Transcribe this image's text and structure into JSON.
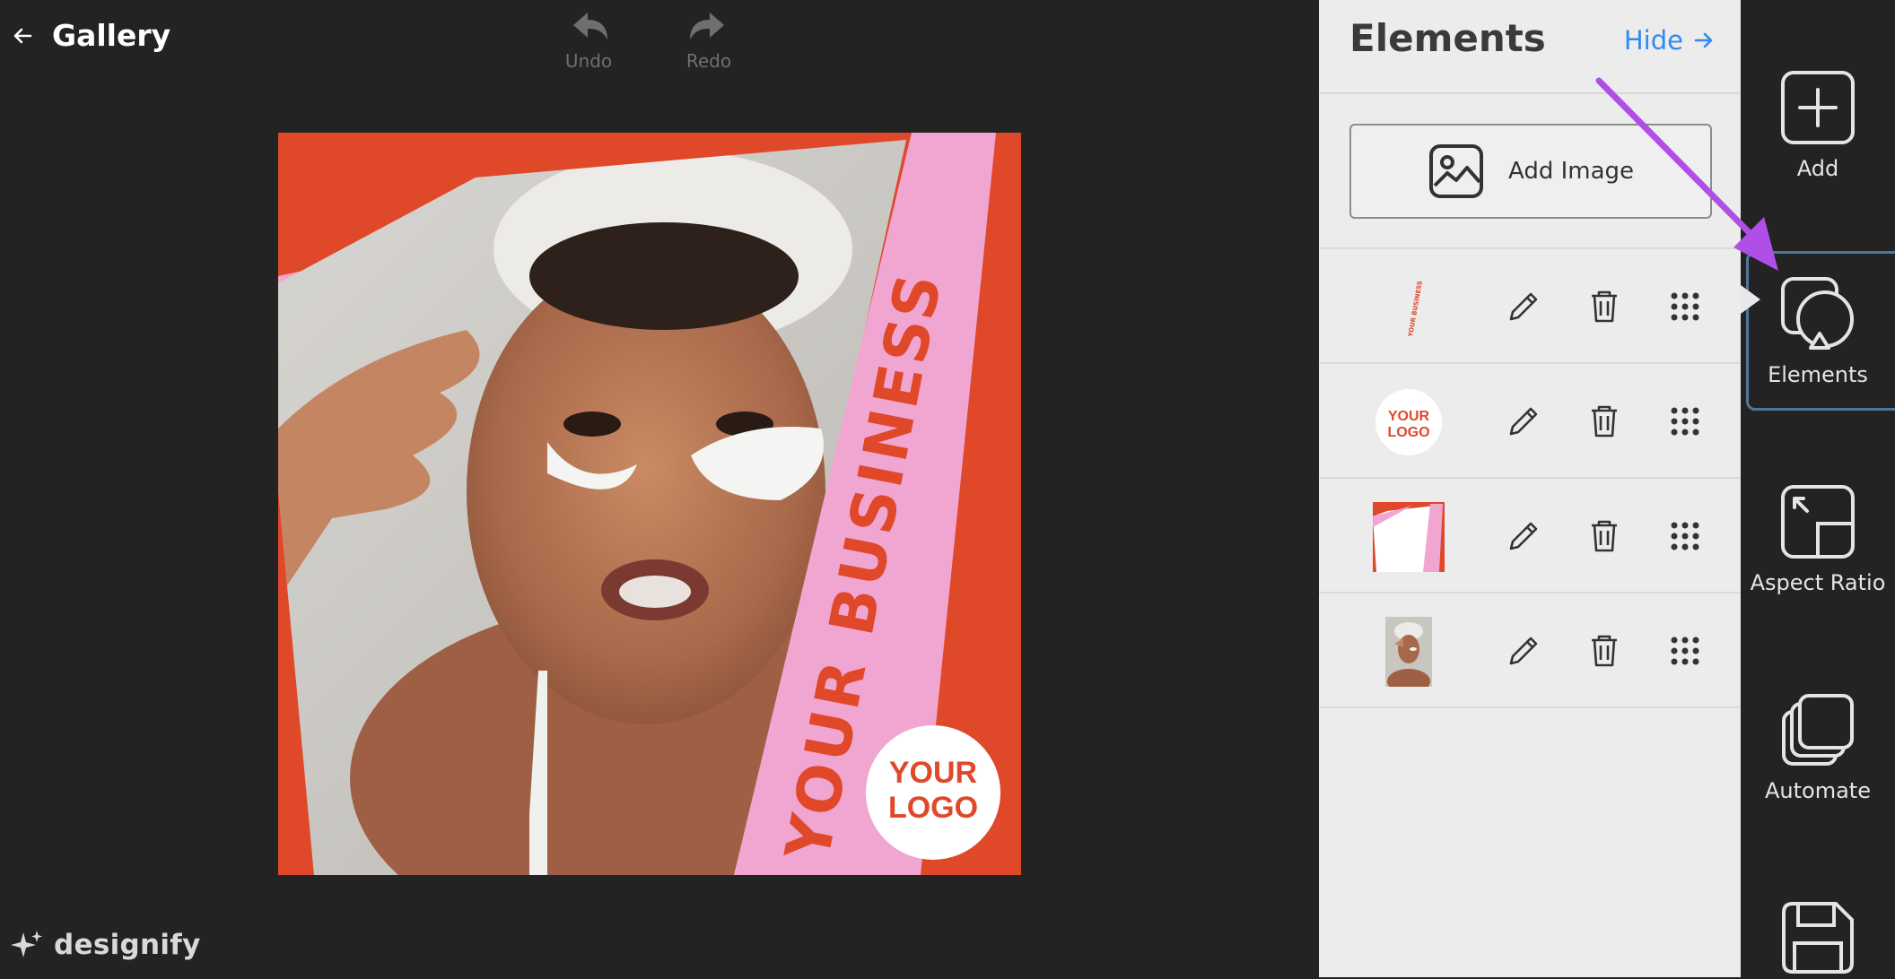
{
  "header": {
    "back_icon": "arrow-left-icon",
    "title": "Gallery",
    "undo_label": "Undo",
    "redo_label": "Redo"
  },
  "canvas": {
    "headline": "YOUR BUSINESS",
    "logo_line1": "YOUR",
    "logo_line2": "LOGO",
    "colors": {
      "background": "#e0482a",
      "stripe": "#f1a6d2",
      "text": "#e0482a"
    }
  },
  "brand": {
    "name": "designify",
    "icon": "sparkle-icon"
  },
  "panel": {
    "title": "Elements",
    "hide_label": "Hide",
    "add_image_label": "Add Image",
    "rows": [
      {
        "thumb": "text-element-thumbnail",
        "thumb_text": "YOUR BUSINESS"
      },
      {
        "thumb": "logo-element-thumbnail",
        "thumb_line1": "YOUR",
        "thumb_line2": "LOGO"
      },
      {
        "thumb": "shape-element-thumbnail"
      },
      {
        "thumb": "photo-element-thumbnail"
      }
    ],
    "row_actions": [
      "pencil-icon",
      "trash-icon",
      "drag-handle-icon"
    ]
  },
  "rail": {
    "items": [
      {
        "label": "Add",
        "icon": "plus-square-icon"
      },
      {
        "label": "Elements",
        "icon": "shapes-icon",
        "active": true
      },
      {
        "label": "Aspect Ratio",
        "icon": "aspect-ratio-icon"
      },
      {
        "label": "Automate",
        "icon": "layers-icon"
      },
      {
        "label": "",
        "icon": "save-icon"
      }
    ]
  },
  "annotation": {
    "arrow_color": "#b04fe8"
  }
}
